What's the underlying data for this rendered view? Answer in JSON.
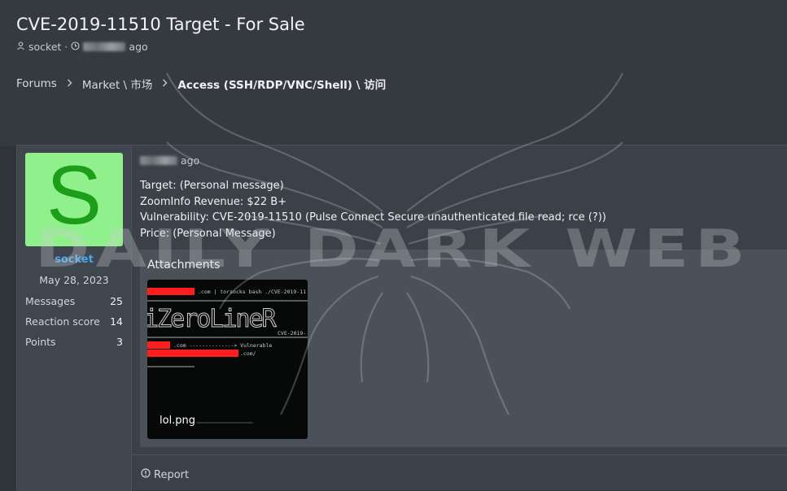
{
  "thread": {
    "title": "CVE-2019-11510 Target - For Sale",
    "author": "socket",
    "separator": "·",
    "time_suffix": "ago"
  },
  "breadcrumbs": [
    "Forums",
    "Market \\ 市场",
    "Access (SSH/RDP/VNC/Shell) \\ 访问"
  ],
  "post": {
    "time_suffix": "ago",
    "lines": [
      "Target: (Personal message)",
      "ZoomInfo Revenue: $22 B+",
      "Vulnerability: CVE-2019-11510 (Pulse Connect Secure unauthenticated file read; rce (?))",
      "Price: (Personal Message)"
    ],
    "report_label": "Report"
  },
  "user": {
    "avatar_letter": "S",
    "avatar_bg": "#8ff08c",
    "avatar_fg": "#1d9e1a",
    "name": "socket",
    "joined": "May 28, 2023",
    "stats": [
      {
        "label": "Messages",
        "value": "25"
      },
      {
        "label": "Reaction score",
        "value": "14"
      },
      {
        "label": "Points",
        "value": "3"
      }
    ]
  },
  "attachments": {
    "title": "Attachments",
    "file_name": "lol.png",
    "thumb_text": {
      "line1": ".com | torsocks bash ./CVE-2019-11",
      "line2": "CVE-2019-",
      "line3": ".com --------------> Vulnerable",
      "line4": ".com/"
    }
  },
  "watermark": {
    "text": "DAILY DARK WEB"
  },
  "icons": {
    "user": "user-icon",
    "clock": "clock-icon",
    "chevron": "chevron-right-icon",
    "report": "report-icon"
  }
}
